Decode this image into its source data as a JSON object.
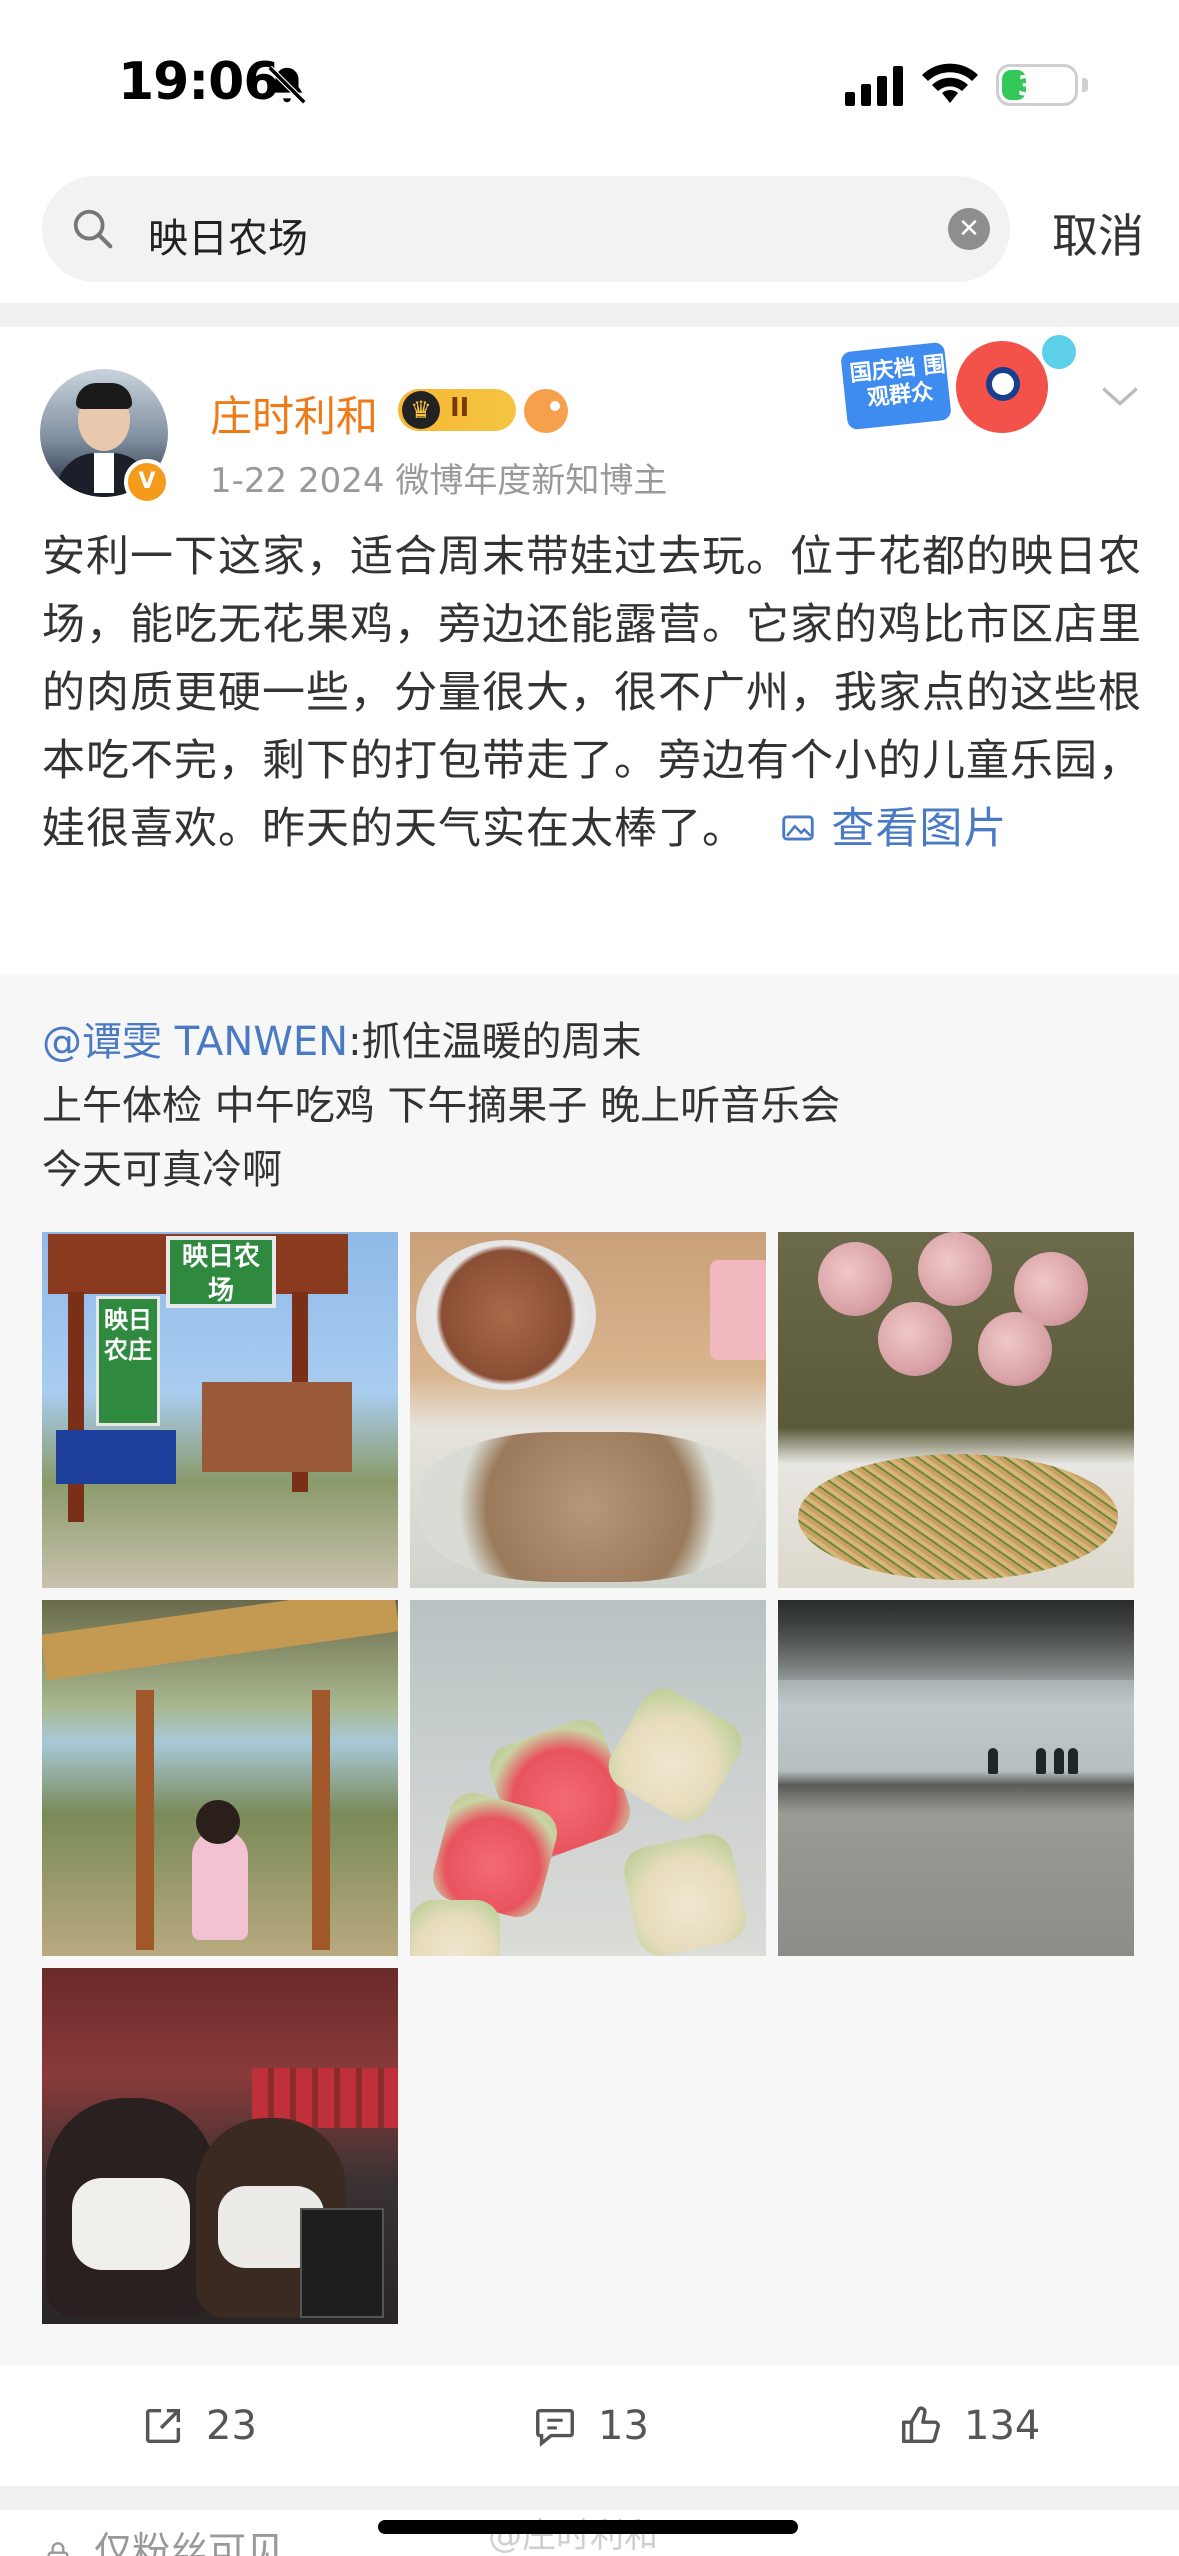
{
  "status_bar": {
    "time": "19:06",
    "battery_level": "31",
    "battery_fraction": 0.31
  },
  "search": {
    "query": "映日农场",
    "cancel_label": "取消"
  },
  "post": {
    "author": "庄时利和",
    "level_badge": "II",
    "date": "1-22",
    "author_title": "2024 微博年度新知博主",
    "promo_banner_text": "国庆档 围观群众",
    "body_text": "安利一下这家，适合周末带娃过去玩。位于花都的映日农场，能吃无花果鸡，旁边还能露营。它家的鸡比市区店里的肉质更硬一些，分量很大，很不广州，我家点的这些根本吃不完，剩下的打包带走了。旁边有个小的儿童乐园，娃很喜欢。昨天的天气实在太棒了。",
    "view_images_label": "查看图片"
  },
  "retweet": {
    "user": "@谭雯 TANWEN",
    "separator": ":",
    "line1": "抓住温暖的周末",
    "line2": "上午体检 中午吃鸡 下午摘果子 晚上听音乐会",
    "line3": "今天可真冷啊",
    "images": [
      {
        "sign_arch": "映日农场",
        "sign_vertical": "映日农庄"
      },
      {},
      {},
      {},
      {},
      {},
      {}
    ]
  },
  "actions": {
    "reposts": "23",
    "comments": "13",
    "likes": "134"
  },
  "next_post": {
    "visibility": "仅粉丝可见",
    "watermark": "@庄时利和"
  },
  "colors": {
    "accent_link": "#4a7ac4",
    "username_orange": "#f07a17",
    "meta_gray": "#999999"
  }
}
